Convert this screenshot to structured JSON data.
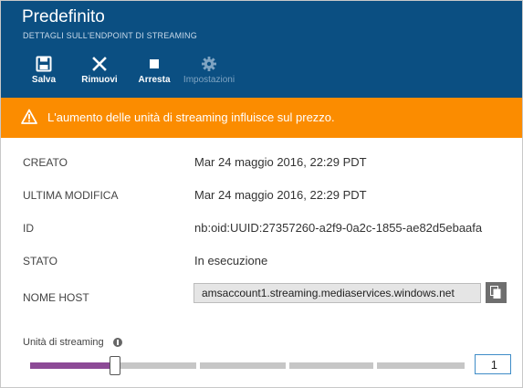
{
  "header": {
    "title": "Predefinito",
    "subtitle": "DETTAGLI SULL'ENDPOINT DI STREAMING",
    "background": "#0b4f82"
  },
  "toolbar": {
    "save_label": "Salva",
    "remove_label": "Rimuovi",
    "stop_label": "Arresta",
    "settings_label": "Impostazioni",
    "settings_disabled": true
  },
  "banner": {
    "text": "L'aumento delle unità di streaming influisce sul prezzo.",
    "color": "#fb8c00"
  },
  "details": {
    "created_label": "CREATO",
    "created_value": "Mar 24 maggio 2016, 22:29 PDT",
    "modified_label": "ULTIMA MODIFICA",
    "modified_value": "Mar 24 maggio 2016, 22:29 PDT",
    "id_label": "ID",
    "id_value": "nb:oid:UUID:27357260-a2f9-0a2c-1855-ae82d5ebaafa",
    "state_label": "STATO",
    "state_value": "In esecuzione",
    "host_label": "NOME HOST",
    "host_value": "amsaccount1.streaming.mediaservices.windows.net"
  },
  "streaming_units": {
    "label": "Unità di streaming",
    "value": "1",
    "slider_accent": "#8c4a96"
  }
}
